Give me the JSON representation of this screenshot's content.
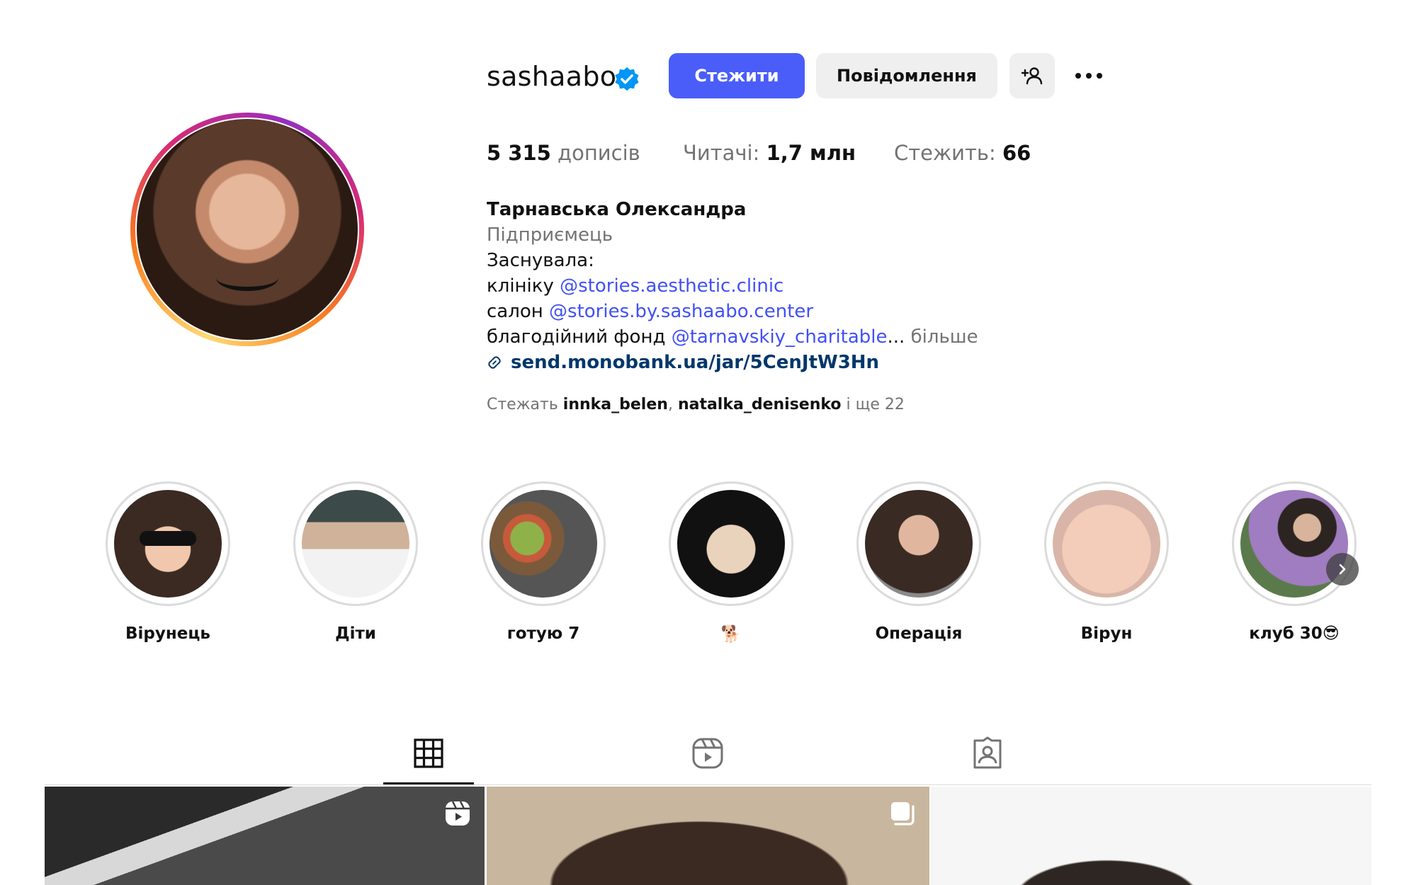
{
  "profile": {
    "username": "sashaabo",
    "follow_label": "Стежити",
    "message_label": "Повідомлення",
    "stats": {
      "posts_value": "5 315",
      "posts_label": " дописів",
      "followers_label": "Читачі: ",
      "followers_value": "1,7 млн",
      "following_label": "Стежить: ",
      "following_value": "66"
    },
    "bio": {
      "full_name": "Тарнавська Олександра",
      "category": "Підприємець",
      "line1": "Заснувала:",
      "line2_prefix": "клініку ",
      "line2_mention": "@stories.aesthetic.clinic",
      "line3_prefix": "салон ",
      "line3_mention": "@stories.by.sashaabo.center",
      "line4_prefix": "благодійний фонд ",
      "line4_mention": "@tarnavskiy_charitable",
      "line4_ellipsis": "...",
      "more_label": " більше",
      "link": "send.monobank.ua/jar/5CenJtW3Hn"
    },
    "followed_by": {
      "prefix": "Стежать ",
      "user1": "innka_belen",
      "separator": ", ",
      "user2": "natalka_denisenko",
      "suffix": " і ще 22"
    }
  },
  "highlights": [
    {
      "label": "Вірунець"
    },
    {
      "label": "Діти"
    },
    {
      "label": "готую 7"
    },
    {
      "label": "🐕"
    },
    {
      "label": "Операція"
    },
    {
      "label": "Вірун"
    },
    {
      "label": "клуб 30😎"
    }
  ],
  "colors": {
    "accent": "#4a5df9",
    "mention": "#4150f7",
    "link": "#00376b",
    "verified": "#0095f6"
  }
}
